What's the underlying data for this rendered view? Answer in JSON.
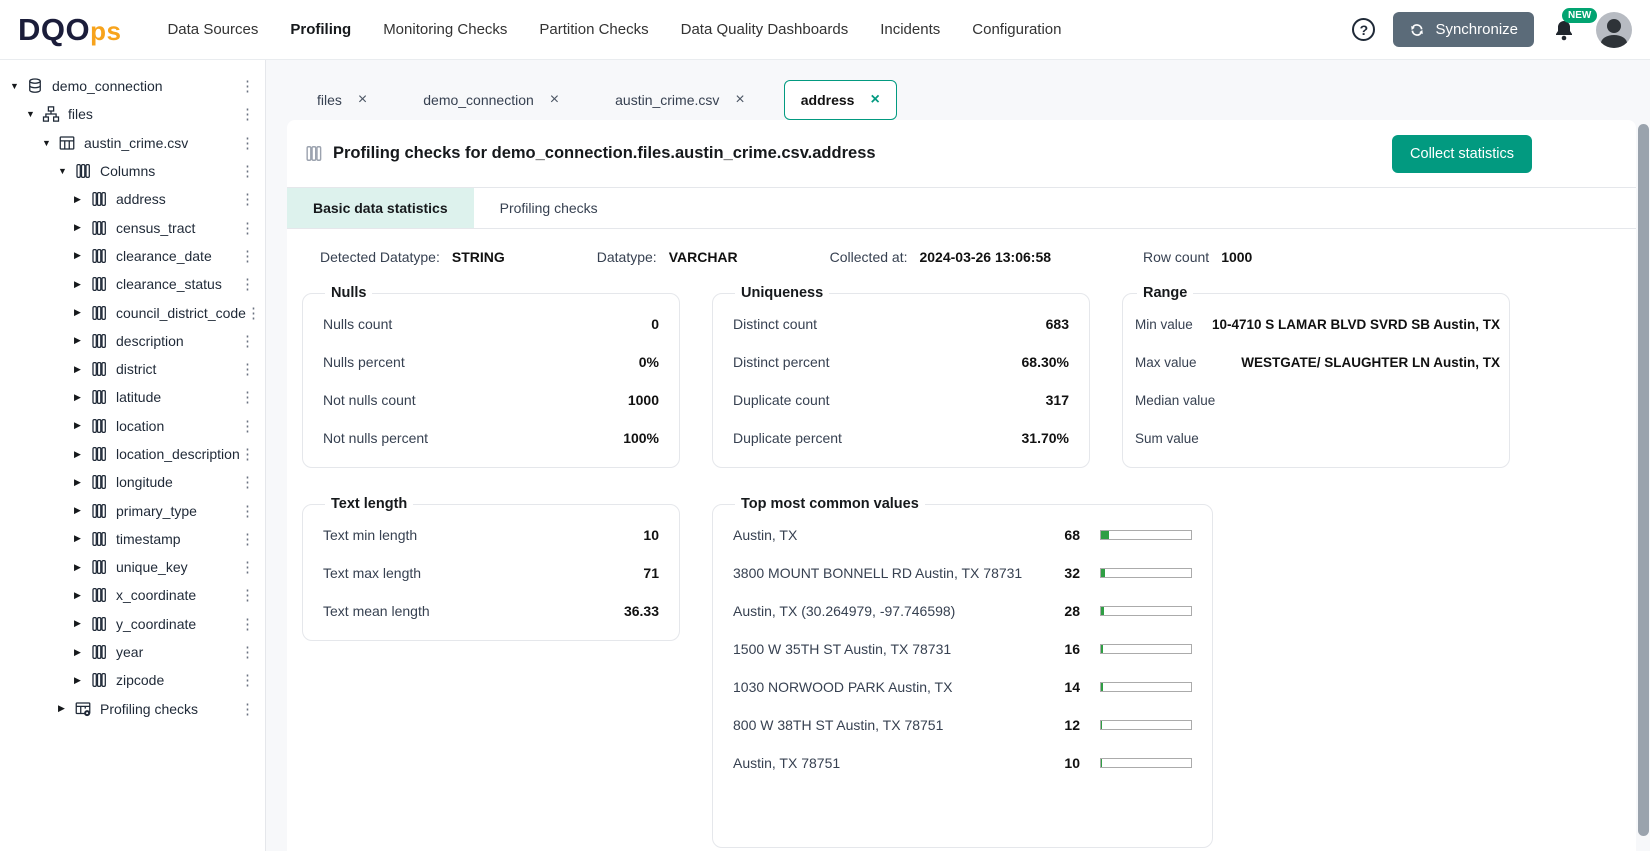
{
  "header": {
    "logo": {
      "part1": "DQO",
      "part2": "ps"
    },
    "nav": [
      {
        "label": "Data Sources",
        "active": false
      },
      {
        "label": "Profiling",
        "active": true
      },
      {
        "label": "Monitoring Checks",
        "active": false
      },
      {
        "label": "Partition Checks",
        "active": false
      },
      {
        "label": "Data Quality Dashboards",
        "active": false
      },
      {
        "label": "Incidents",
        "active": false
      },
      {
        "label": "Configuration",
        "active": false
      }
    ],
    "help_label": "?",
    "synchronize_label": "Synchronize",
    "notification_badge": "NEW"
  },
  "sidebar": {
    "tree": [
      {
        "label": "demo_connection",
        "level": 0,
        "expanded": true,
        "icon": "database"
      },
      {
        "label": "files",
        "level": 1,
        "expanded": true,
        "icon": "schema"
      },
      {
        "label": "austin_crime.csv",
        "level": 2,
        "expanded": true,
        "icon": "table"
      },
      {
        "label": "Columns",
        "level": 3,
        "expanded": true,
        "icon": "columns"
      },
      {
        "label": "address",
        "level": 4,
        "expanded": false,
        "icon": "column"
      },
      {
        "label": "census_tract",
        "level": 4,
        "expanded": false,
        "icon": "column"
      },
      {
        "label": "clearance_date",
        "level": 4,
        "expanded": false,
        "icon": "column"
      },
      {
        "label": "clearance_status",
        "level": 4,
        "expanded": false,
        "icon": "column"
      },
      {
        "label": "council_district_code",
        "level": 4,
        "expanded": false,
        "icon": "column"
      },
      {
        "label": "description",
        "level": 4,
        "expanded": false,
        "icon": "column"
      },
      {
        "label": "district",
        "level": 4,
        "expanded": false,
        "icon": "column"
      },
      {
        "label": "latitude",
        "level": 4,
        "expanded": false,
        "icon": "column"
      },
      {
        "label": "location",
        "level": 4,
        "expanded": false,
        "icon": "column"
      },
      {
        "label": "location_description",
        "level": 4,
        "expanded": false,
        "icon": "column"
      },
      {
        "label": "longitude",
        "level": 4,
        "expanded": false,
        "icon": "column"
      },
      {
        "label": "primary_type",
        "level": 4,
        "expanded": false,
        "icon": "column"
      },
      {
        "label": "timestamp",
        "level": 4,
        "expanded": false,
        "icon": "column"
      },
      {
        "label": "unique_key",
        "level": 4,
        "expanded": false,
        "icon": "column"
      },
      {
        "label": "x_coordinate",
        "level": 4,
        "expanded": false,
        "icon": "column"
      },
      {
        "label": "y_coordinate",
        "level": 4,
        "expanded": false,
        "icon": "column"
      },
      {
        "label": "year",
        "level": 4,
        "expanded": false,
        "icon": "column"
      },
      {
        "label": "zipcode",
        "level": 4,
        "expanded": false,
        "icon": "column"
      },
      {
        "label": "Profiling checks",
        "level": 3,
        "expanded": false,
        "icon": "table-checks"
      }
    ]
  },
  "tabs": [
    {
      "label": "files",
      "active": false
    },
    {
      "label": "demo_connection",
      "active": false
    },
    {
      "label": "austin_crime.csv",
      "active": false
    },
    {
      "label": "address",
      "active": true
    }
  ],
  "main": {
    "title": "Profiling checks for demo_connection.files.austin_crime.csv.address",
    "collect_button": "Collect statistics",
    "panel_toggle": "<",
    "subtabs": [
      {
        "label": "Basic data statistics",
        "active": true
      },
      {
        "label": "Profiling checks",
        "active": false
      }
    ],
    "meta": [
      {
        "label": "Detected Datatype:",
        "value": "STRING"
      },
      {
        "label": "Datatype:",
        "value": "VARCHAR"
      },
      {
        "label": "Collected at:",
        "value": "2024-03-26 13:06:58"
      },
      {
        "label": "Row count",
        "value": "1000"
      }
    ],
    "cards": {
      "nulls": {
        "title": "Nulls",
        "rows": [
          [
            "Nulls count",
            "0"
          ],
          [
            "Nulls percent",
            "0%"
          ],
          [
            "Not nulls count",
            "1000"
          ],
          [
            "Not nulls percent",
            "100%"
          ]
        ]
      },
      "uniqueness": {
        "title": "Uniqueness",
        "rows": [
          [
            "Distinct count",
            "683"
          ],
          [
            "Distinct percent",
            "68.30%"
          ],
          [
            "Duplicate count",
            "317"
          ],
          [
            "Duplicate percent",
            "31.70%"
          ]
        ]
      },
      "range": {
        "title": "Range",
        "rows": [
          [
            "Min value",
            "10-4710 S LAMAR BLVD SVRD SB Austin, TX"
          ],
          [
            "Max value",
            "WESTGATE/ SLAUGHTER LN Austin, TX"
          ],
          [
            "Median value",
            ""
          ],
          [
            "Sum value",
            ""
          ]
        ]
      },
      "text_length": {
        "title": "Text length",
        "rows": [
          [
            "Text min length",
            "10"
          ],
          [
            "Text max length",
            "71"
          ],
          [
            "Text mean length",
            "36.33"
          ]
        ]
      },
      "top_values": {
        "title": "Top most common values",
        "rows": [
          {
            "label": "Austin, TX",
            "count": 68
          },
          {
            "label": "3800 MOUNT BONNELL RD Austin, TX 78731",
            "count": 32
          },
          {
            "label": "Austin, TX (30.264979, -97.746598)",
            "count": 28
          },
          {
            "label": "1500 W 35TH ST Austin, TX 78731",
            "count": 16
          },
          {
            "label": "1030 NORWOOD PARK Austin, TX",
            "count": 14
          },
          {
            "label": "800 W 38TH ST Austin, TX 78751",
            "count": 12
          },
          {
            "label": "Austin, TX 78751",
            "count": 10
          }
        ]
      }
    }
  }
}
